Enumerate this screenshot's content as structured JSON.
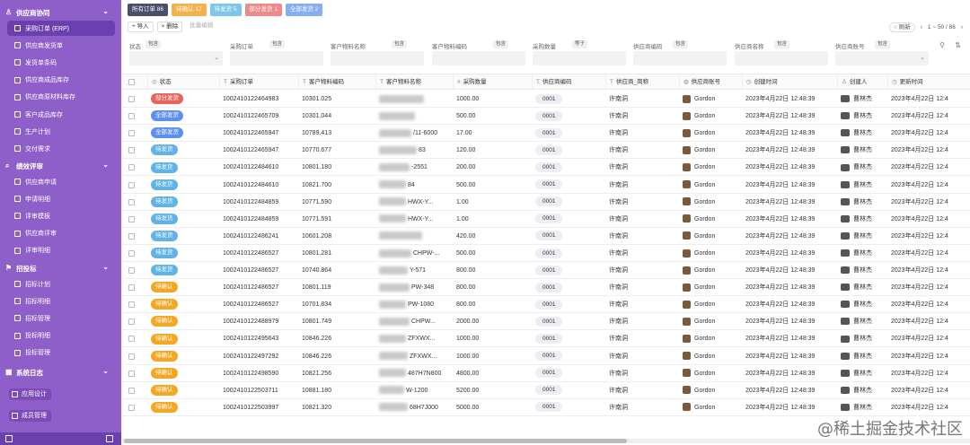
{
  "sidebar": {
    "groups": [
      {
        "label": "供应商协同",
        "icon": "user-icon"
      },
      {
        "label": "绩效评审",
        "icon": "search-icon"
      },
      {
        "label": "招投标",
        "icon": "flag-icon"
      },
      {
        "label": "系统日志",
        "icon": "calendar-icon"
      }
    ],
    "items": [
      {
        "label": "采购订单 (ERP)",
        "active": true
      },
      {
        "label": "供应商发货单"
      },
      {
        "label": "发货单条码"
      },
      {
        "label": "供应商成品库存"
      },
      {
        "label": "供应商原材料库存"
      },
      {
        "label": "客户成品库存"
      },
      {
        "label": "生产计划"
      },
      {
        "label": "交付需求"
      },
      {
        "label": "供应商申请"
      },
      {
        "label": "申请明细"
      },
      {
        "label": "评审模板"
      },
      {
        "label": "供应商评审"
      },
      {
        "label": "评审明细"
      },
      {
        "label": "招标计划"
      },
      {
        "label": "招标明细"
      },
      {
        "label": "招标管理"
      },
      {
        "label": "投标明细"
      },
      {
        "label": "投标管理"
      }
    ],
    "buttons": [
      "应用设计",
      "成员管理"
    ]
  },
  "tabs": [
    {
      "label": "所有订单 86",
      "color": "#4a4f6a"
    },
    {
      "label": "待确认 17",
      "color": "#f3b24b"
    },
    {
      "label": "待发货 5",
      "color": "#7fc6e8"
    },
    {
      "label": "部分发货 1",
      "color": "#ef8a8a"
    },
    {
      "label": "全部发货 2",
      "color": "#86aef0"
    }
  ],
  "toolbar": {
    "import": "+ 导入",
    "delete": "× 删除",
    "batch_edit": "批量编辑"
  },
  "pager": {
    "refresh": "刷新",
    "range": "1 ~ 50 / 86"
  },
  "filters": [
    {
      "label": "状态",
      "mode": "包含"
    },
    {
      "label": "采购订单",
      "mode": "包含"
    },
    {
      "label": "客户物料名称",
      "mode": "包含"
    },
    {
      "label": "客户物料编码",
      "mode": "包含"
    },
    {
      "label": "采购数量",
      "mode": "等于"
    },
    {
      "label": "供应商编码",
      "mode": "包含"
    },
    {
      "label": "供应商名称",
      "mode": "包含"
    },
    {
      "label": "供应商账号",
      "mode": "包含"
    }
  ],
  "columns": [
    "状态",
    "采购订单",
    "客户物料编码",
    "客户物料名称",
    "采购数量",
    "供应商编码",
    "供应商_简称",
    "供应商账号",
    "创建时间",
    "创建人",
    "更新时间"
  ],
  "colors": {
    "部分发货": "#e8645a",
    "全部发货": "#5b8ff0",
    "待发货": "#5fb3e6",
    "待确认": "#f5a623"
  },
  "rows": [
    {
      "status": "部分发货",
      "po": "1002410122464983",
      "code": "10301.025",
      "name": "",
      "qty": "1000.00",
      "vcode": "0001",
      "vname": "许南洞",
      "acct": "Gordon",
      "created": "2023年4月22日 12:48:39",
      "creator": "曹林杰",
      "updated": "2023年4月22日 12:4"
    },
    {
      "status": "全部发货",
      "po": "1002410122465709",
      "code": "10301.044",
      "name": "",
      "qty": "500.00",
      "vcode": "0001",
      "vname": "许南洞",
      "acct": "Gordon",
      "created": "2023年4月22日 12:48:39",
      "creator": "曹林杰",
      "updated": "2023年4月22日 12:4"
    },
    {
      "status": "全部发货",
      "po": "1002410122465947",
      "code": "10789.413",
      "name": "/11-6000",
      "qty": "17.00",
      "vcode": "0001",
      "vname": "许南洞",
      "acct": "Gordon",
      "created": "2023年4月22日 12:48:39",
      "creator": "曹林杰",
      "updated": "2023年4月22日 12:4"
    },
    {
      "status": "待发货",
      "po": "1002410122465947",
      "code": "10770.677",
      "name": "83",
      "qty": "120.00",
      "vcode": "0001",
      "vname": "许南洞",
      "acct": "Gordon",
      "created": "2023年4月22日 12:48:39",
      "creator": "曹林杰",
      "updated": "2023年4月22日 12:4"
    },
    {
      "status": "待发货",
      "po": "1002410122484610",
      "code": "10801.180",
      "name": "-2551",
      "qty": "200.00",
      "vcode": "0001",
      "vname": "许南洞",
      "acct": "Gordon",
      "created": "2023年4月22日 12:48:39",
      "creator": "曹林杰",
      "updated": "2023年4月22日 12:4"
    },
    {
      "status": "待发货",
      "po": "1002410122484610",
      "code": "10821.700",
      "name": "84",
      "qty": "500.00",
      "vcode": "0001",
      "vname": "许南洞",
      "acct": "Gordon",
      "created": "2023年4月22日 12:48:39",
      "creator": "曹林杰",
      "updated": "2023年4月22日 12:4"
    },
    {
      "status": "待发货",
      "po": "1002410122484859",
      "code": "10771.590",
      "name": "HWX-Y...",
      "qty": "1.00",
      "vcode": "0001",
      "vname": "许南洞",
      "acct": "Gordon",
      "created": "2023年4月22日 12:48:39",
      "creator": "曹林杰",
      "updated": "2023年4月22日 12:4"
    },
    {
      "status": "待发货",
      "po": "1002410122484859",
      "code": "10771.591",
      "name": "HWX-Y...",
      "qty": "1.00",
      "vcode": "0001",
      "vname": "许南洞",
      "acct": "Gordon",
      "created": "2023年4月22日 12:48:39",
      "creator": "曹林杰",
      "updated": "2023年4月22日 12:4"
    },
    {
      "status": "待发货",
      "po": "1002410122486241",
      "code": "10601.208",
      "name": "",
      "qty": "420.00",
      "vcode": "0001",
      "vname": "许南洞",
      "acct": "Gordon",
      "created": "2023年4月22日 12:48:39",
      "creator": "曹林杰",
      "updated": "2023年4月22日 12:4"
    },
    {
      "status": "待发货",
      "po": "1002410122486527",
      "code": "10801.281",
      "name": "CHPW-...",
      "qty": "500.00",
      "vcode": "0001",
      "vname": "许南洞",
      "acct": "Gordon",
      "created": "2023年4月22日 12:48:39",
      "creator": "曹林杰",
      "updated": "2023年4月22日 12:4"
    },
    {
      "status": "待发货",
      "po": "1002410122486527",
      "code": "10740.864",
      "name": "Y-571",
      "qty": "800.00",
      "vcode": "0001",
      "vname": "许南洞",
      "acct": "Gordon",
      "created": "2023年4月22日 12:48:39",
      "creator": "曹林杰",
      "updated": "2023年4月22日 12:4"
    },
    {
      "status": "待确认",
      "po": "1002410122486527",
      "code": "10801.119",
      "name": "PW-348",
      "qty": "800.00",
      "vcode": "0001",
      "vname": "许南洞",
      "acct": "Gordon",
      "created": "2023年4月22日 12:48:39",
      "creator": "曹林杰",
      "updated": "2023年4月22日 12:4"
    },
    {
      "status": "待确认",
      "po": "1002410122486527",
      "code": "10701.834",
      "name": "PW-1080",
      "qty": "800.00",
      "vcode": "0001",
      "vname": "许南洞",
      "acct": "Gordon",
      "created": "2023年4月22日 12:48:39",
      "creator": "曹林杰",
      "updated": "2023年4月22日 12:4"
    },
    {
      "status": "待确认",
      "po": "1002410122488979",
      "code": "10801.749",
      "name": "CHPW...",
      "qty": "2000.00",
      "vcode": "0001",
      "vname": "许南洞",
      "acct": "Gordon",
      "created": "2023年4月22日 12:48:39",
      "creator": "曹林杰",
      "updated": "2023年4月22日 12:4"
    },
    {
      "status": "待确认",
      "po": "1002410122495643",
      "code": "10846.226",
      "name": "ZFXWX...",
      "qty": "1000.00",
      "vcode": "0001",
      "vname": "许南洞",
      "acct": "Gordon",
      "created": "2023年4月22日 12:48:39",
      "creator": "曹林杰",
      "updated": "2023年4月22日 12:4"
    },
    {
      "status": "待确认",
      "po": "1002410122497292",
      "code": "10846.226",
      "name": "ZFXWX...",
      "qty": "1000.00",
      "vcode": "0001",
      "vname": "许南洞",
      "acct": "Gordon",
      "created": "2023年4月22日 12:48:39",
      "creator": "曹林杰",
      "updated": "2023年4月22日 12:4"
    },
    {
      "status": "待确认",
      "po": "1002410122498590",
      "code": "10821.256",
      "name": "487H7N800",
      "qty": "4800.00",
      "vcode": "0001",
      "vname": "许南洞",
      "acct": "Gordon",
      "created": "2023年4月22日 12:48:39",
      "creator": "曹林杰",
      "updated": "2023年4月22日 12:4"
    },
    {
      "status": "待确认",
      "po": "1002410122503711",
      "code": "10881.180",
      "name": "W-1200",
      "qty": "5200.00",
      "vcode": "0001",
      "vname": "许南洞",
      "acct": "Gordon",
      "created": "2023年4月22日 12:48:39",
      "creator": "曹林杰",
      "updated": "2023年4月22日 12:4"
    },
    {
      "status": "待确认",
      "po": "1002410122503997",
      "code": "10821.320",
      "name": "68H7J000",
      "qty": "5000.00",
      "vcode": "0001",
      "vname": "许南洞",
      "acct": "Gordon",
      "created": "2023年4月22日 12:48:39",
      "creator": "曹林杰",
      "updated": "2023年4月22日 12:4"
    }
  ],
  "watermark": "@稀土掘金技术社区"
}
